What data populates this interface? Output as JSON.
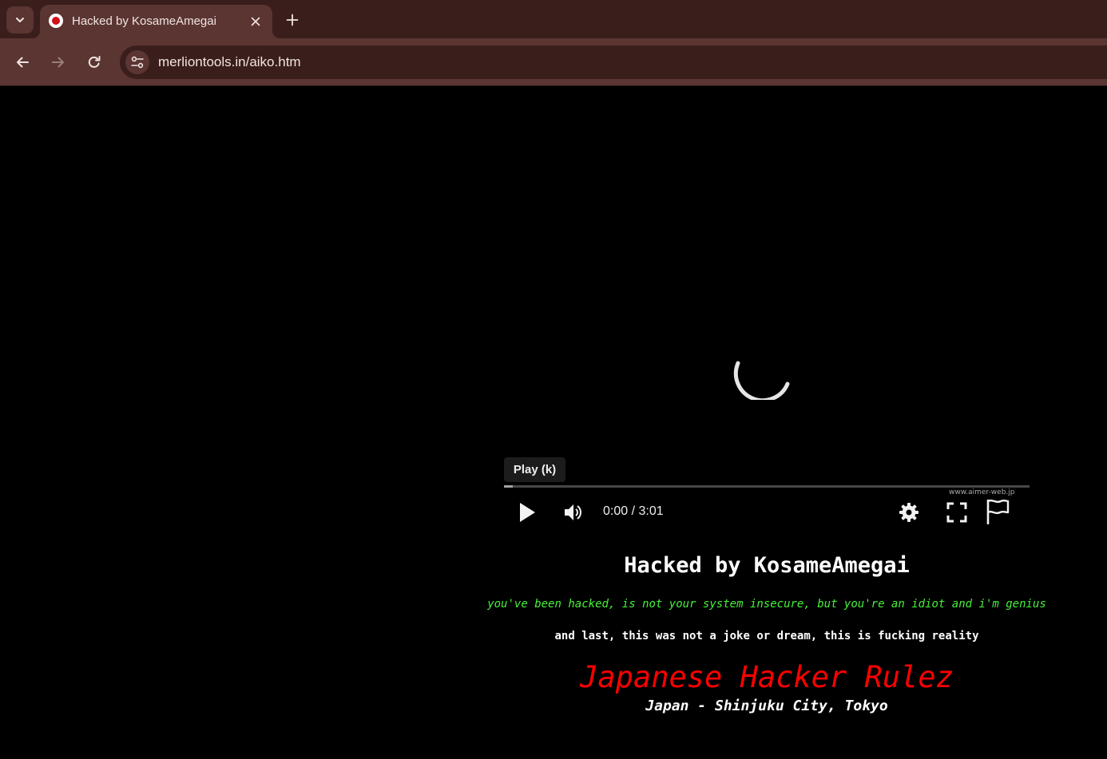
{
  "browser": {
    "tab": {
      "title": "Hacked by KosameAmegai",
      "favicon": "red-circle-icon",
      "favicon_color": "#d4101a"
    },
    "address_bar": {
      "url": "merliontools.in/aiko.htm"
    },
    "icons": {
      "tab_search": "chevron-down-icon",
      "close_tab": "close-icon",
      "new_tab": "plus-icon",
      "back": "arrow-left-icon",
      "forward": "arrow-right-icon",
      "reload": "reload-icon",
      "site_info": "tune-icon"
    },
    "colors": {
      "tabstrip": "#3a1e1c",
      "toolbar": "#5a3532"
    }
  },
  "video_player": {
    "tooltip": "Play (k)",
    "time": "0:00 / 3:01",
    "watermark": "www.aimer-web.jp",
    "state": "loading",
    "icons": [
      "spinner-icon",
      "play-icon",
      "volume-icon",
      "settings-gear-icon",
      "fullscreen-icon",
      "flag-icon"
    ]
  },
  "message": {
    "title": "Hacked by KosameAmegai",
    "line1": "you've been hacked, is not your system insecure, but you're an idiot and i'm genius",
    "line2": "and last, this was not a joke or dream, this is fucking reality",
    "slogan": "Japanese Hacker Rulez",
    "location": "Japan - Shinjuku City, Tokyo",
    "colors": {
      "line1": "#46f23a",
      "slogan": "#ff0000",
      "background": "#000000"
    }
  }
}
